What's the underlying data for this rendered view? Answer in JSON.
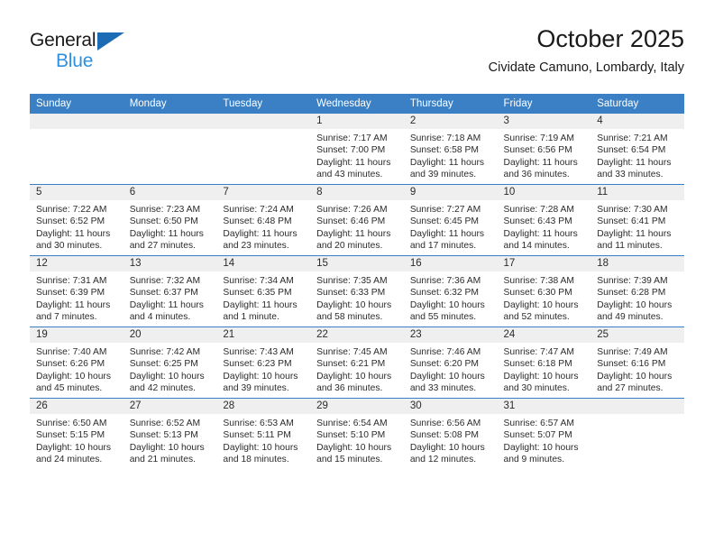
{
  "brand": {
    "logo_line1": "General",
    "logo_line2": "Blue",
    "accent_color": "#3b7fc4",
    "logo_blue": "#2e90e0",
    "triangle_color": "#1b6cb5"
  },
  "header": {
    "title": "October 2025",
    "subtitle": "Cividate Camuno, Lombardy, Italy"
  },
  "calendar": {
    "weekday_headers": [
      "Sunday",
      "Monday",
      "Tuesday",
      "Wednesday",
      "Thursday",
      "Friday",
      "Saturday"
    ],
    "weeks": [
      [
        {
          "day": "",
          "sunrise": "",
          "sunset": "",
          "daylight_line1": "",
          "daylight_line2": ""
        },
        {
          "day": "",
          "sunrise": "",
          "sunset": "",
          "daylight_line1": "",
          "daylight_line2": ""
        },
        {
          "day": "",
          "sunrise": "",
          "sunset": "",
          "daylight_line1": "",
          "daylight_line2": ""
        },
        {
          "day": "1",
          "sunrise": "Sunrise: 7:17 AM",
          "sunset": "Sunset: 7:00 PM",
          "daylight_line1": "Daylight: 11 hours",
          "daylight_line2": "and 43 minutes."
        },
        {
          "day": "2",
          "sunrise": "Sunrise: 7:18 AM",
          "sunset": "Sunset: 6:58 PM",
          "daylight_line1": "Daylight: 11 hours",
          "daylight_line2": "and 39 minutes."
        },
        {
          "day": "3",
          "sunrise": "Sunrise: 7:19 AM",
          "sunset": "Sunset: 6:56 PM",
          "daylight_line1": "Daylight: 11 hours",
          "daylight_line2": "and 36 minutes."
        },
        {
          "day": "4",
          "sunrise": "Sunrise: 7:21 AM",
          "sunset": "Sunset: 6:54 PM",
          "daylight_line1": "Daylight: 11 hours",
          "daylight_line2": "and 33 minutes."
        }
      ],
      [
        {
          "day": "5",
          "sunrise": "Sunrise: 7:22 AM",
          "sunset": "Sunset: 6:52 PM",
          "daylight_line1": "Daylight: 11 hours",
          "daylight_line2": "and 30 minutes."
        },
        {
          "day": "6",
          "sunrise": "Sunrise: 7:23 AM",
          "sunset": "Sunset: 6:50 PM",
          "daylight_line1": "Daylight: 11 hours",
          "daylight_line2": "and 27 minutes."
        },
        {
          "day": "7",
          "sunrise": "Sunrise: 7:24 AM",
          "sunset": "Sunset: 6:48 PM",
          "daylight_line1": "Daylight: 11 hours",
          "daylight_line2": "and 23 minutes."
        },
        {
          "day": "8",
          "sunrise": "Sunrise: 7:26 AM",
          "sunset": "Sunset: 6:46 PM",
          "daylight_line1": "Daylight: 11 hours",
          "daylight_line2": "and 20 minutes."
        },
        {
          "day": "9",
          "sunrise": "Sunrise: 7:27 AM",
          "sunset": "Sunset: 6:45 PM",
          "daylight_line1": "Daylight: 11 hours",
          "daylight_line2": "and 17 minutes."
        },
        {
          "day": "10",
          "sunrise": "Sunrise: 7:28 AM",
          "sunset": "Sunset: 6:43 PM",
          "daylight_line1": "Daylight: 11 hours",
          "daylight_line2": "and 14 minutes."
        },
        {
          "day": "11",
          "sunrise": "Sunrise: 7:30 AM",
          "sunset": "Sunset: 6:41 PM",
          "daylight_line1": "Daylight: 11 hours",
          "daylight_line2": "and 11 minutes."
        }
      ],
      [
        {
          "day": "12",
          "sunrise": "Sunrise: 7:31 AM",
          "sunset": "Sunset: 6:39 PM",
          "daylight_line1": "Daylight: 11 hours",
          "daylight_line2": "and 7 minutes."
        },
        {
          "day": "13",
          "sunrise": "Sunrise: 7:32 AM",
          "sunset": "Sunset: 6:37 PM",
          "daylight_line1": "Daylight: 11 hours",
          "daylight_line2": "and 4 minutes."
        },
        {
          "day": "14",
          "sunrise": "Sunrise: 7:34 AM",
          "sunset": "Sunset: 6:35 PM",
          "daylight_line1": "Daylight: 11 hours",
          "daylight_line2": "and 1 minute."
        },
        {
          "day": "15",
          "sunrise": "Sunrise: 7:35 AM",
          "sunset": "Sunset: 6:33 PM",
          "daylight_line1": "Daylight: 10 hours",
          "daylight_line2": "and 58 minutes."
        },
        {
          "day": "16",
          "sunrise": "Sunrise: 7:36 AM",
          "sunset": "Sunset: 6:32 PM",
          "daylight_line1": "Daylight: 10 hours",
          "daylight_line2": "and 55 minutes."
        },
        {
          "day": "17",
          "sunrise": "Sunrise: 7:38 AM",
          "sunset": "Sunset: 6:30 PM",
          "daylight_line1": "Daylight: 10 hours",
          "daylight_line2": "and 52 minutes."
        },
        {
          "day": "18",
          "sunrise": "Sunrise: 7:39 AM",
          "sunset": "Sunset: 6:28 PM",
          "daylight_line1": "Daylight: 10 hours",
          "daylight_line2": "and 49 minutes."
        }
      ],
      [
        {
          "day": "19",
          "sunrise": "Sunrise: 7:40 AM",
          "sunset": "Sunset: 6:26 PM",
          "daylight_line1": "Daylight: 10 hours",
          "daylight_line2": "and 45 minutes."
        },
        {
          "day": "20",
          "sunrise": "Sunrise: 7:42 AM",
          "sunset": "Sunset: 6:25 PM",
          "daylight_line1": "Daylight: 10 hours",
          "daylight_line2": "and 42 minutes."
        },
        {
          "day": "21",
          "sunrise": "Sunrise: 7:43 AM",
          "sunset": "Sunset: 6:23 PM",
          "daylight_line1": "Daylight: 10 hours",
          "daylight_line2": "and 39 minutes."
        },
        {
          "day": "22",
          "sunrise": "Sunrise: 7:45 AM",
          "sunset": "Sunset: 6:21 PM",
          "daylight_line1": "Daylight: 10 hours",
          "daylight_line2": "and 36 minutes."
        },
        {
          "day": "23",
          "sunrise": "Sunrise: 7:46 AM",
          "sunset": "Sunset: 6:20 PM",
          "daylight_line1": "Daylight: 10 hours",
          "daylight_line2": "and 33 minutes."
        },
        {
          "day": "24",
          "sunrise": "Sunrise: 7:47 AM",
          "sunset": "Sunset: 6:18 PM",
          "daylight_line1": "Daylight: 10 hours",
          "daylight_line2": "and 30 minutes."
        },
        {
          "day": "25",
          "sunrise": "Sunrise: 7:49 AM",
          "sunset": "Sunset: 6:16 PM",
          "daylight_line1": "Daylight: 10 hours",
          "daylight_line2": "and 27 minutes."
        }
      ],
      [
        {
          "day": "26",
          "sunrise": "Sunrise: 6:50 AM",
          "sunset": "Sunset: 5:15 PM",
          "daylight_line1": "Daylight: 10 hours",
          "daylight_line2": "and 24 minutes."
        },
        {
          "day": "27",
          "sunrise": "Sunrise: 6:52 AM",
          "sunset": "Sunset: 5:13 PM",
          "daylight_line1": "Daylight: 10 hours",
          "daylight_line2": "and 21 minutes."
        },
        {
          "day": "28",
          "sunrise": "Sunrise: 6:53 AM",
          "sunset": "Sunset: 5:11 PM",
          "daylight_line1": "Daylight: 10 hours",
          "daylight_line2": "and 18 minutes."
        },
        {
          "day": "29",
          "sunrise": "Sunrise: 6:54 AM",
          "sunset": "Sunset: 5:10 PM",
          "daylight_line1": "Daylight: 10 hours",
          "daylight_line2": "and 15 minutes."
        },
        {
          "day": "30",
          "sunrise": "Sunrise: 6:56 AM",
          "sunset": "Sunset: 5:08 PM",
          "daylight_line1": "Daylight: 10 hours",
          "daylight_line2": "and 12 minutes."
        },
        {
          "day": "31",
          "sunrise": "Sunrise: 6:57 AM",
          "sunset": "Sunset: 5:07 PM",
          "daylight_line1": "Daylight: 10 hours",
          "daylight_line2": "and 9 minutes."
        },
        {
          "day": "",
          "sunrise": "",
          "sunset": "",
          "daylight_line1": "",
          "daylight_line2": ""
        }
      ]
    ]
  }
}
